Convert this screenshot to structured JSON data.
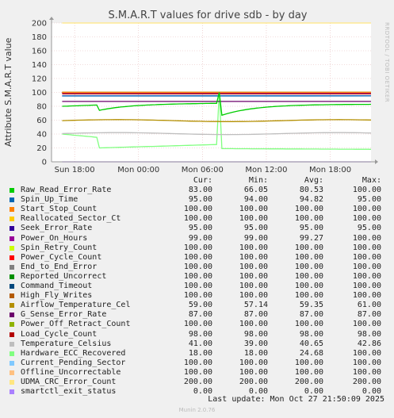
{
  "chart_data": {
    "type": "line",
    "title": "S.M.A.R.T values for drive sdb - by day",
    "ylabel": "Attribute S.M.A.R.T value",
    "side_label": "RRDTOOL / TOBI OETIKER",
    "ylim": [
      0,
      200
    ],
    "yticks": [
      0,
      20,
      40,
      60,
      80,
      100,
      120,
      140,
      160,
      180,
      200
    ],
    "xlim_hours": [
      -30,
      0
    ],
    "xticks": [
      {
        "label": "Sun 18:00",
        "hours": -27.83
      },
      {
        "label": "Mon 00:00",
        "hours": -21.83
      },
      {
        "label": "Mon 06:00",
        "hours": -15.83
      },
      {
        "label": "Mon 12:00",
        "hours": -9.83
      },
      {
        "label": "Mon 18:00",
        "hours": -3.83
      }
    ],
    "grid": true,
    "legend_headers": [
      "Cur:",
      "Min:",
      "Avg:",
      "Max:"
    ],
    "series": [
      {
        "name": "Raw_Read_Error_Rate",
        "color": "#00cc00",
        "cur": "83.00",
        "min": "66.05",
        "avg": "80.53",
        "max": "100.00",
        "shape": "recover"
      },
      {
        "name": "Spin_Up_Time",
        "color": "#0066b3",
        "cur": "95.00",
        "min": "94.00",
        "avg": "94.82",
        "max": "95.00",
        "shape": "flat"
      },
      {
        "name": "Start_Stop_Count",
        "color": "#ff8000",
        "cur": "100.00",
        "min": "100.00",
        "avg": "100.00",
        "max": "100.00",
        "shape": "flat"
      },
      {
        "name": "Reallocated_Sector_Ct",
        "color": "#ffcc00",
        "cur": "100.00",
        "min": "100.00",
        "avg": "100.00",
        "max": "100.00",
        "shape": "flat"
      },
      {
        "name": "Seek_Error_Rate",
        "color": "#330099",
        "cur": "95.00",
        "min": "95.00",
        "avg": "95.00",
        "max": "95.00",
        "shape": "flat"
      },
      {
        "name": "Power_On_Hours",
        "color": "#990099",
        "cur": "99.00",
        "min": "99.00",
        "avg": "99.27",
        "max": "100.00",
        "shape": "flat"
      },
      {
        "name": "Spin_Retry_Count",
        "color": "#ccff00",
        "cur": "100.00",
        "min": "100.00",
        "avg": "100.00",
        "max": "100.00",
        "shape": "flat"
      },
      {
        "name": "Power_Cycle_Count",
        "color": "#ff0000",
        "cur": "100.00",
        "min": "100.00",
        "avg": "100.00",
        "max": "100.00",
        "shape": "flat"
      },
      {
        "name": "End_to_End_Error",
        "color": "#808080",
        "cur": "100.00",
        "min": "100.00",
        "avg": "100.00",
        "max": "100.00",
        "shape": "flat"
      },
      {
        "name": "Reported_Uncorrect",
        "color": "#008f00",
        "cur": "100.00",
        "min": "100.00",
        "avg": "100.00",
        "max": "100.00",
        "shape": "flat"
      },
      {
        "name": "Command_Timeout",
        "color": "#00487d",
        "cur": "100.00",
        "min": "100.00",
        "avg": "100.00",
        "max": "100.00",
        "shape": "flat"
      },
      {
        "name": "High_Fly_Writes",
        "color": "#b35a00",
        "cur": "100.00",
        "min": "100.00",
        "avg": "100.00",
        "max": "100.00",
        "shape": "flat"
      },
      {
        "name": "Airflow_Temperature_Cel",
        "color": "#b38f00",
        "cur": "59.00",
        "min": "57.14",
        "avg": "59.35",
        "max": "61.00",
        "shape": "temp"
      },
      {
        "name": "G_Sense_Error_Rate",
        "color": "#6b006b",
        "cur": "87.00",
        "min": "87.00",
        "avg": "87.00",
        "max": "87.00",
        "shape": "flat"
      },
      {
        "name": "Power_Off_Retract_Count",
        "color": "#8fb300",
        "cur": "100.00",
        "min": "100.00",
        "avg": "100.00",
        "max": "100.00",
        "shape": "flat"
      },
      {
        "name": "Load_Cycle_Count",
        "color": "#b30000",
        "cur": "98.00",
        "min": "98.00",
        "avg": "98.00",
        "max": "98.00",
        "shape": "flat"
      },
      {
        "name": "Temperature_Celsius",
        "color": "#bebebe",
        "cur": "41.00",
        "min": "39.00",
        "avg": "40.65",
        "max": "42.86",
        "shape": "temp"
      },
      {
        "name": "Hardware_ECC_Recovered",
        "color": "#80ff80",
        "cur": "18.00",
        "min": "18.00",
        "avg": "24.68",
        "max": "100.00",
        "shape": "ecc"
      },
      {
        "name": "Current_Pending_Sector",
        "color": "#80c9ff",
        "cur": "100.00",
        "min": "100.00",
        "avg": "100.00",
        "max": "100.00",
        "shape": "flat"
      },
      {
        "name": "Offline_Uncorrectable",
        "color": "#ffc080",
        "cur": "100.00",
        "min": "100.00",
        "avg": "100.00",
        "max": "100.00",
        "shape": "flat"
      },
      {
        "name": "UDMA_CRC_Error_Count",
        "color": "#ffe680",
        "cur": "200.00",
        "min": "200.00",
        "avg": "200.00",
        "max": "200.00",
        "shape": "flat"
      },
      {
        "name": "smartctl_exit_status",
        "color": "#aa80ff",
        "cur": "0.00",
        "min": "0.00",
        "avg": "0.00",
        "max": "0.00",
        "shape": "flat"
      }
    ]
  },
  "last_update": "Last update: Mon Oct 27 21:50:09 2025",
  "footer": "Munin 2.0.76"
}
